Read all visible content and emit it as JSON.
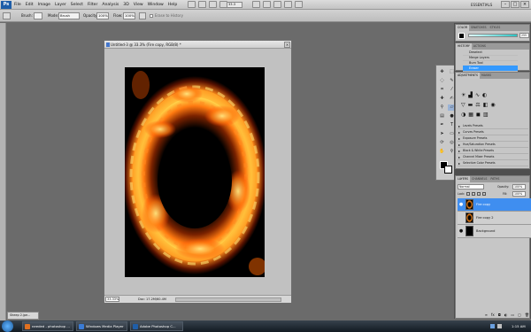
{
  "app": {
    "logo": "Ps",
    "menus": [
      "File",
      "Edit",
      "Image",
      "Layer",
      "Select",
      "Filter",
      "Analysis",
      "3D",
      "View",
      "Window",
      "Help"
    ],
    "zoom_dropdown": "33.3",
    "workspace": "ESSENTIALS",
    "window_controls": [
      "–",
      "□",
      "×"
    ]
  },
  "options_bar": {
    "brush_label": "Brush:",
    "mode_label": "Mode:",
    "mode_value": "Brush",
    "opacity_label": "Opacity:",
    "opacity_value": "100%",
    "flow_label": "Flow:",
    "flow_value": "100%",
    "history_checkbox_label": "Erase to History"
  },
  "document": {
    "title": "Untitled-3 @ 33.3% (Fire copy, RGB/8) *",
    "close": "×",
    "zoom": "33.33%",
    "doc_size": "Doc: 17.2M/60.4M"
  },
  "history_panel": {
    "tabs": [
      "HISTORY",
      "ACTIONS"
    ],
    "items": [
      "Deselect",
      "Merge Layers",
      "Burn Tool",
      "Eraser"
    ],
    "selected_index": 3
  },
  "color_panel": {
    "tabs": [
      "COLOR",
      "SWATCHES",
      "STYLES"
    ],
    "value": "255"
  },
  "adjustments_panel": {
    "tabs": [
      "ADJUSTMENTS",
      "MASKS"
    ],
    "presets": [
      "Levels Presets",
      "Curves Presets",
      "Exposure Presets",
      "Hue/Saturation Presets",
      "Black & White Presets",
      "Channel Mixer Presets",
      "Selective Color Presets"
    ]
  },
  "layers_panel": {
    "tabs": [
      "LAYERS",
      "CHANNELS",
      "PATHS"
    ],
    "blend_mode": "Normal",
    "opacity_label": "Opacity:",
    "opacity_value": "100%",
    "lock_label": "Lock:",
    "fill_label": "Fill:",
    "fill_value": "100%",
    "layers": [
      {
        "name": "Fire copy",
        "selected": true,
        "visible": true
      },
      {
        "name": "Fire copy 2",
        "selected": false,
        "visible": false
      },
      {
        "name": "Background",
        "selected": false,
        "visible": true
      }
    ]
  },
  "small_window": {
    "title": "Sheep 2.jpe..."
  },
  "taskbar": {
    "tasks": [
      {
        "label": "needed - photoshop ...",
        "color": "#e07020"
      },
      {
        "label": "Windows Media Player",
        "color": "#3a7bd5"
      },
      {
        "label": "Adobe Photoshop C...",
        "color": "#1f5ea8"
      }
    ],
    "clock": "1:15 AM"
  }
}
